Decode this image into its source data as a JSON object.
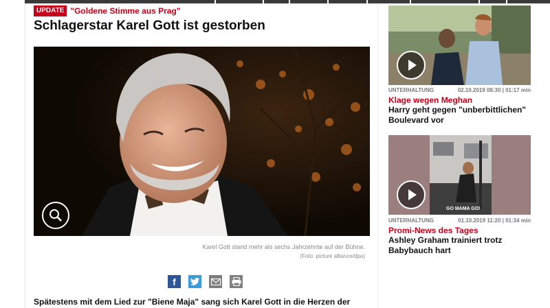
{
  "article": {
    "badge": "UPDATE",
    "kicker": "\"Goldene Stimme aus Prag\"",
    "headline": "Schlagerstar Karel Gott ist gestorben",
    "caption": "Karel Gott stand mehr als sechs Jahrzehnte auf der Bühne.",
    "credit": "(Foto: picture alliance/dpa)",
    "body_start": "Spätestens mit dem Lied zur \"Biene Maja\" sang sich Karel Gott in die Herzen der"
  },
  "share": [
    {
      "icon": "facebook-icon",
      "glyph": "f"
    },
    {
      "icon": "twitter-icon"
    },
    {
      "icon": "mail-icon"
    },
    {
      "icon": "print-icon"
    }
  ],
  "sidebar": {
    "cards": [
      {
        "category": "UNTERHALTUNG",
        "time": "02.10.2019 08:30 | 01:17 min",
        "kicker": "Klage wegen Meghan",
        "title": "Harry geht gegen \"unberbittlichen\" Boulevard vor"
      },
      {
        "category": "UNTERHALTUNG",
        "time": "01.10.2019 11:20 | 01:34 min",
        "kicker": "Promi-News des Tages",
        "title": "Ashley Graham trainiert trotz Babybauch hart",
        "thumb_text": "GO MAMA GO!"
      }
    ]
  },
  "colors": {
    "accent": "#c5001a",
    "nav": "#3a3a3a",
    "facebook": "#2f5597",
    "twitter": "#3c9bd9"
  }
}
